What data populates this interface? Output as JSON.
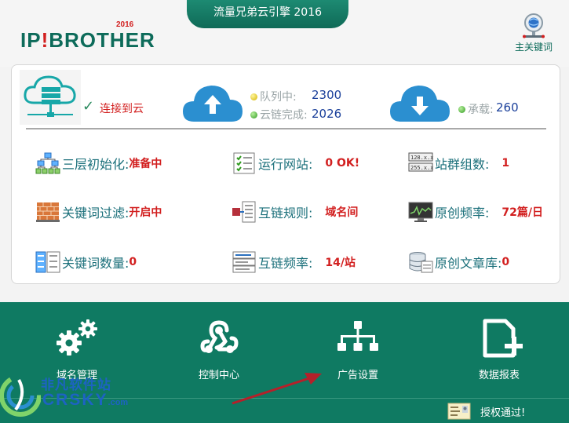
{
  "window": {
    "title": "流量兄弟云引擎 2016"
  },
  "logo": {
    "text_a": "IP",
    "text_bang": "!",
    "text_b": "BROTHER",
    "year": "2016"
  },
  "header": {
    "keyword_label": "主关键词"
  },
  "status": {
    "connection": "连接到云",
    "queue_label": "队列中:",
    "queue_value": "2300",
    "chain_done_label": "云链完成:",
    "chain_done_value": "2026",
    "load_label": "承载:",
    "load_value": "260"
  },
  "items": {
    "init_label": "三层初始化:",
    "init_value": "准备中",
    "run_site_label": "运行网站:",
    "run_site_value": "0 OK!",
    "group_label": "站群组数:",
    "group_value": "1",
    "filter_label": "关键词过滤:",
    "filter_value": "开启中",
    "rule_label": "互链规则:",
    "rule_value": "域名间",
    "freq_label": "原创频率:",
    "freq_value": "72篇/日",
    "kw_count_label": "关键词数量:",
    "kw_count_value": "0",
    "link_freq_label": "互链频率:",
    "link_freq_value": "14/站",
    "lib_label": "原创文章库:",
    "lib_value": "0"
  },
  "nav": {
    "domain": "域名管理",
    "control": "控制中心",
    "ads": "广告设置",
    "report": "数据报表"
  },
  "footer": {
    "auth": "授权通过!"
  },
  "watermark": {
    "line1": "非凡软件站",
    "line2": "CRSKY",
    "line2_suffix": ".com"
  },
  "colors": {
    "brand_green": "#0f7a62",
    "cloud_blue": "#2b8fd0",
    "alert_red": "#d21f1f",
    "value_blue": "#1a3f9a"
  }
}
